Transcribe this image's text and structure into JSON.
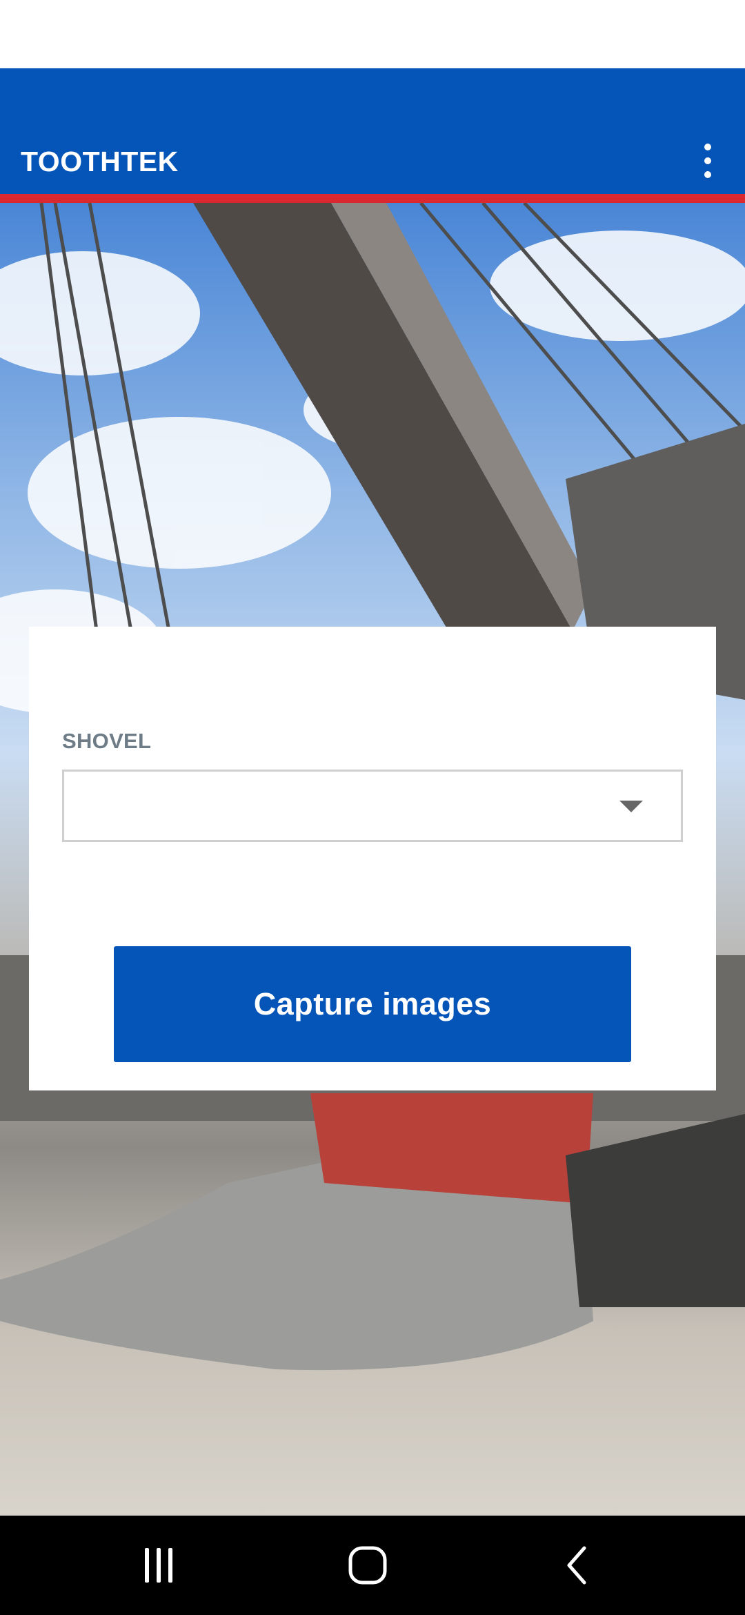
{
  "app": {
    "title": "TOOTHTEK",
    "menu_icon": "more-vert-icon",
    "brand_color": "#0555b8",
    "accent_color": "#d9282f"
  },
  "form": {
    "shovel_label": "SHOVEL",
    "shovel_value": "",
    "capture_button_label": "Capture images"
  },
  "navigation": {
    "recents_icon": "recent-apps-icon",
    "home_icon": "home-icon",
    "back_icon": "back-icon"
  }
}
